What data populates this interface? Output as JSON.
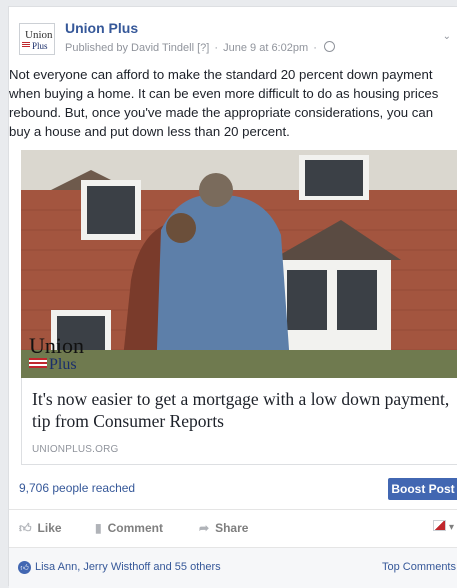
{
  "post": {
    "page_name": "Union Plus",
    "published_by": "Published by David Tindell",
    "published_marker": "[?]",
    "date": "June 9 at 6:02pm",
    "text_lines": [
      "Not everyone can afford to make the standard 20 percent down payment",
      "when buying a home. It can be even more difficult to do as housing prices",
      "rebound. But, once you've made the appropriate considerations, you can",
      "buy a house and put down less than 20 percent."
    ]
  },
  "logo": {
    "line1": "Union",
    "line2": "Plus"
  },
  "photo_logo": {
    "line1": "Union",
    "line2": "Plus"
  },
  "link": {
    "title": "It's now easier to get a mortgage with a low down payment, tip from Consumer Reports",
    "domain": "UNIONPLUS.ORG"
  },
  "stats": {
    "reached": "9,706 people reached",
    "boost_label": "Boost Post"
  },
  "actions": {
    "like": "Like",
    "comment": "Comment",
    "share": "Share"
  },
  "likes": {
    "names": "Lisa Ann, Jerry Wisthoff and 55 others",
    "top_comments": "Top Comments"
  },
  "icons": [
    "globe-icon",
    "like-icon",
    "comment-icon",
    "share-icon",
    "chevron-down-icon"
  ],
  "colors": {
    "link_blue": "#365899",
    "boost_blue": "#4267b2",
    "meta_gray": "#90949c"
  }
}
